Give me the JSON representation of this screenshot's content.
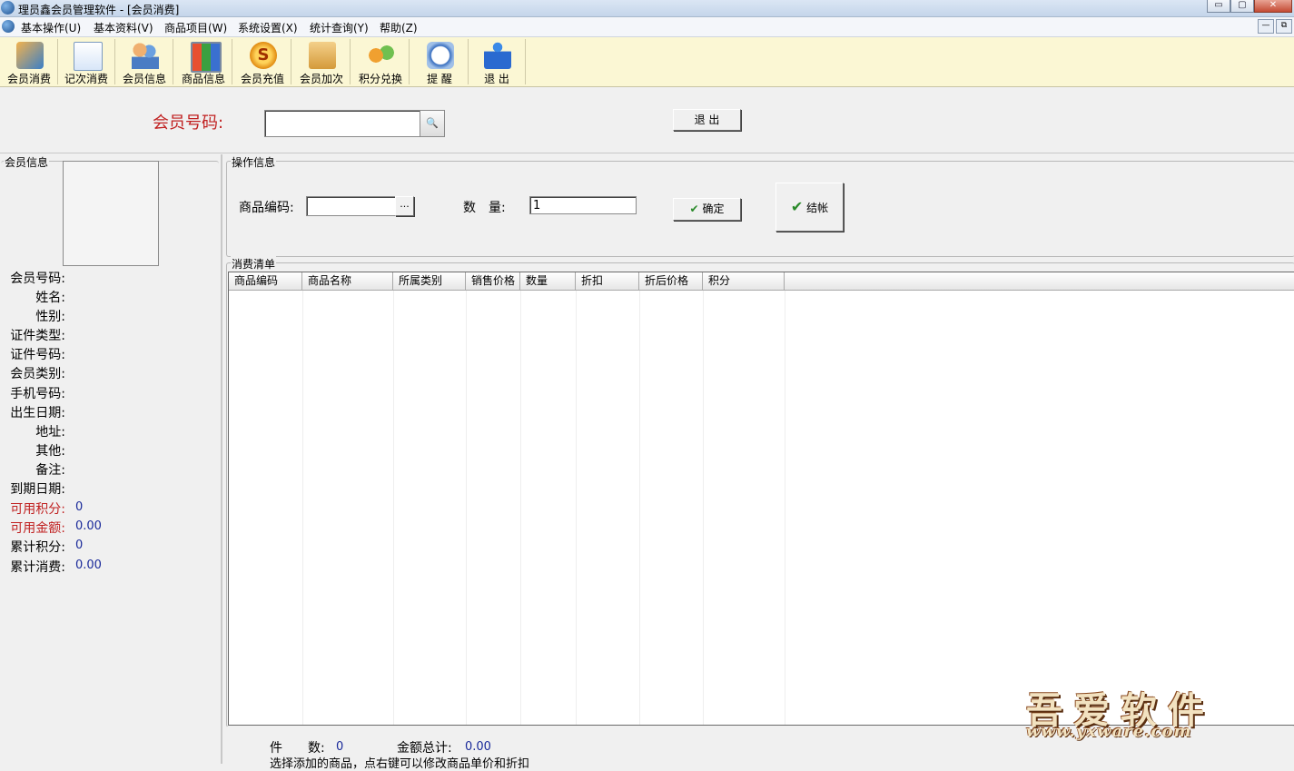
{
  "window": {
    "title": "理员鑫会员管理软件 - [会员消费]",
    "min": "▭",
    "max": "▢",
    "close": "✕"
  },
  "menu": [
    "基本操作(U)",
    "基本资料(V)",
    "商品项目(W)",
    "系统设置(X)",
    "统计查询(Y)",
    "帮助(Z)"
  ],
  "mdi": {
    "min": "—",
    "restore": "⧉"
  },
  "toolbar": [
    {
      "label": "会员消费",
      "icon": "card-icon"
    },
    {
      "label": "记次消费",
      "icon": "note-icon"
    },
    {
      "label": "会员信息",
      "icon": "people-icon"
    },
    {
      "label": "商品信息",
      "icon": "grid-icon"
    },
    {
      "label": "会员充值",
      "icon": "coin-icon",
      "glyph": "S"
    },
    {
      "label": "会员加次",
      "icon": "folder-icon"
    },
    {
      "label": "积分兑换",
      "icon": "score-icon"
    },
    {
      "label": "提 醒",
      "icon": "clock-icon"
    },
    {
      "label": "退 出",
      "icon": "exit-icon"
    }
  ],
  "filter": {
    "member_no_label": "会员号码:",
    "member_no_value": "",
    "search_glyph": "🔍",
    "exit_button": "退 出"
  },
  "member_info": {
    "title": "会员信息",
    "fields": [
      {
        "label": "会员号码:",
        "value": ""
      },
      {
        "label": "姓名:",
        "value": ""
      },
      {
        "label": "性别:",
        "value": ""
      },
      {
        "label": "证件类型:",
        "value": ""
      },
      {
        "label": "证件号码:",
        "value": ""
      },
      {
        "label": "会员类别:",
        "value": ""
      },
      {
        "label": "手机号码:",
        "value": ""
      },
      {
        "label": "出生日期:",
        "value": ""
      },
      {
        "label": "地址:",
        "value": ""
      },
      {
        "label": "其他:",
        "value": ""
      },
      {
        "label": "备注:",
        "value": ""
      },
      {
        "label": "到期日期:",
        "value": ""
      },
      {
        "label": "可用积分:",
        "value": "0",
        "highlight": true
      },
      {
        "label": "可用金额:",
        "value": "0.00",
        "highlight": true
      },
      {
        "label": "累计积分:",
        "value": "0"
      },
      {
        "label": "累计消费:",
        "value": "0.00"
      }
    ]
  },
  "operation": {
    "title": "操作信息",
    "product_code_label": "商品编码:",
    "product_code_value": "",
    "browse_glyph": "...",
    "qty_label": "数　量:",
    "qty_value": "1",
    "confirm_button": "确定",
    "checkout_button": "结帐",
    "check_glyph": "✔"
  },
  "list": {
    "title": "消费清单",
    "columns": [
      "商品编码",
      "商品名称",
      "所属类别",
      "销售价格",
      "数量",
      "折扣",
      "折后价格",
      "积分"
    ],
    "rows": []
  },
  "footer": {
    "count_label": "件　　数:",
    "count_value": "0",
    "total_label": "金额总计:",
    "total_value": "0.00",
    "hint": "选择添加的商品，点右键可以修改商品单价和折扣"
  },
  "watermark": {
    "cn": "吾爱软件",
    "url": "www.yxware.com"
  }
}
